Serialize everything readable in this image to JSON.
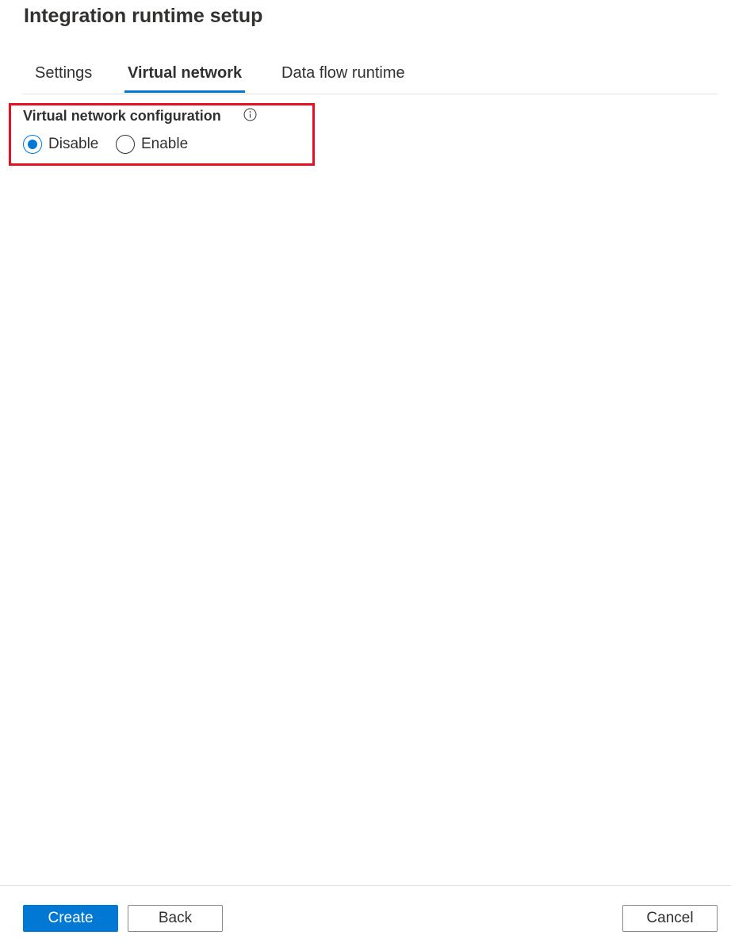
{
  "window": {
    "title": "Integration runtime setup"
  },
  "tabs": [
    {
      "label": "Settings",
      "active": false
    },
    {
      "label": "Virtual network",
      "active": true
    },
    {
      "label": "Data flow runtime",
      "active": false
    }
  ],
  "vnet_config": {
    "label": "Virtual network configuration",
    "info_icon": "info-icon",
    "options": [
      {
        "label": "Disable",
        "selected": true
      },
      {
        "label": "Enable",
        "selected": false
      }
    ],
    "selected": "Disable"
  },
  "highlight_color": "#e81123",
  "accent_color": "#0078d4",
  "footer": {
    "create_label": "Create",
    "back_label": "Back",
    "cancel_label": "Cancel"
  }
}
